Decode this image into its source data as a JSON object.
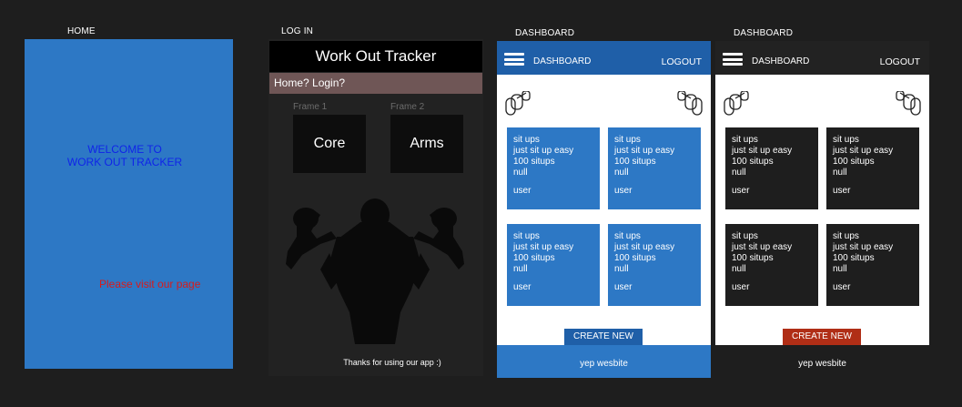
{
  "labels": {
    "home": "HOME",
    "login": "LOG IN",
    "dashboard1": "DASHBOARD",
    "dashboard2": "DASHBOARD"
  },
  "home": {
    "welcome_line1": "WELCOME TO",
    "welcome_line2": "WORK OUT TRACKER",
    "visit": "Please visit our page"
  },
  "login": {
    "title": "Work Out Tracker",
    "nav": "Home? Login?",
    "tiles": [
      {
        "caption": "Frame 1",
        "label": "Core"
      },
      {
        "caption": "Frame 2",
        "label": "Arms"
      }
    ],
    "thanks": "Thanks for using our app :)"
  },
  "dashboard": {
    "header_title": "DASHBOARD",
    "logout": "LOGOUT",
    "cards": [
      {
        "title": "sit ups",
        "desc": "just sit up easy",
        "count": "100 situps",
        "extra": "null",
        "user": "user"
      },
      {
        "title": "sit ups",
        "desc": "just sit up easy",
        "count": "100 situps",
        "extra": "null",
        "user": "user"
      },
      {
        "title": "sit ups",
        "desc": "just sit up easy",
        "count": "100 situps",
        "extra": "null",
        "user": "user"
      },
      {
        "title": "sit ups",
        "desc": "just sit up easy",
        "count": "100 situps",
        "extra": "null",
        "user": "user"
      }
    ],
    "create": "CREATE NEW",
    "footer": "yep wesbite"
  },
  "colors": {
    "background": "#1e1e1e",
    "home_blue": "#2d78c5",
    "header_blue": "#1f5fa8",
    "welcome_text": "#1024e8",
    "visit_text": "#d81b1b",
    "login_nav": "#6f5656",
    "create_red": "#b02e16"
  },
  "icons": [
    "hamburger-icon",
    "dumbbell-icon",
    "bodybuilder-silhouette"
  ]
}
